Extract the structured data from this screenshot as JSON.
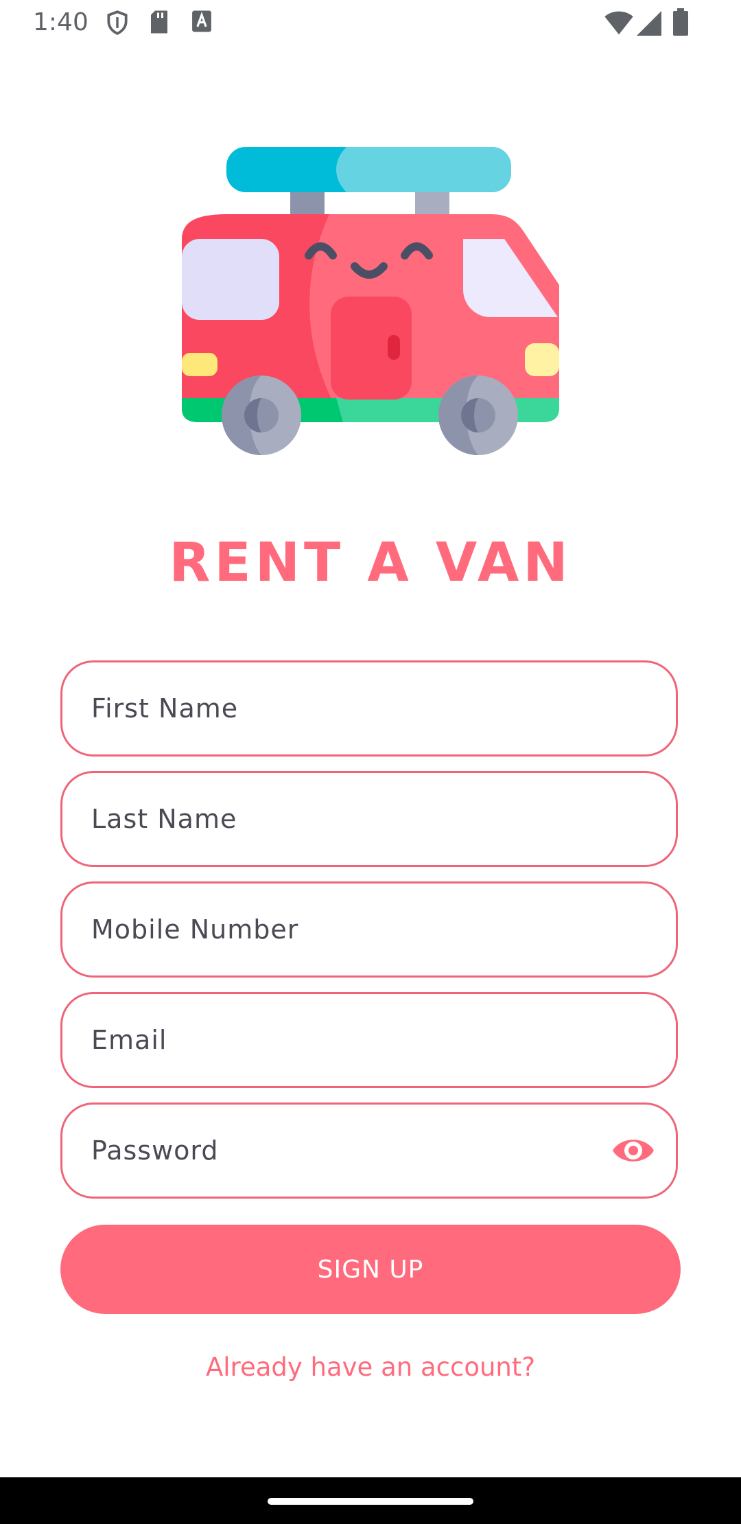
{
  "status_bar": {
    "time": "1:40",
    "icons": [
      "shield-icon",
      "sd-card-icon",
      "font-a-icon",
      "wifi-icon",
      "signal-icon",
      "battery-icon"
    ]
  },
  "hero": {
    "illustration": "van-illustration"
  },
  "app": {
    "title": "RENT A VAN"
  },
  "form": {
    "first_name_placeholder": "First Name",
    "last_name_placeholder": "Last Name",
    "mobile_placeholder": "Mobile Number",
    "email_placeholder": "Email",
    "password_placeholder": "Password",
    "signup_label": "SIGN UP",
    "login_link": "Already have an account?"
  },
  "colors": {
    "accent": "#ff6b7d",
    "field_border": "#f06478",
    "background": "#ffffff"
  }
}
